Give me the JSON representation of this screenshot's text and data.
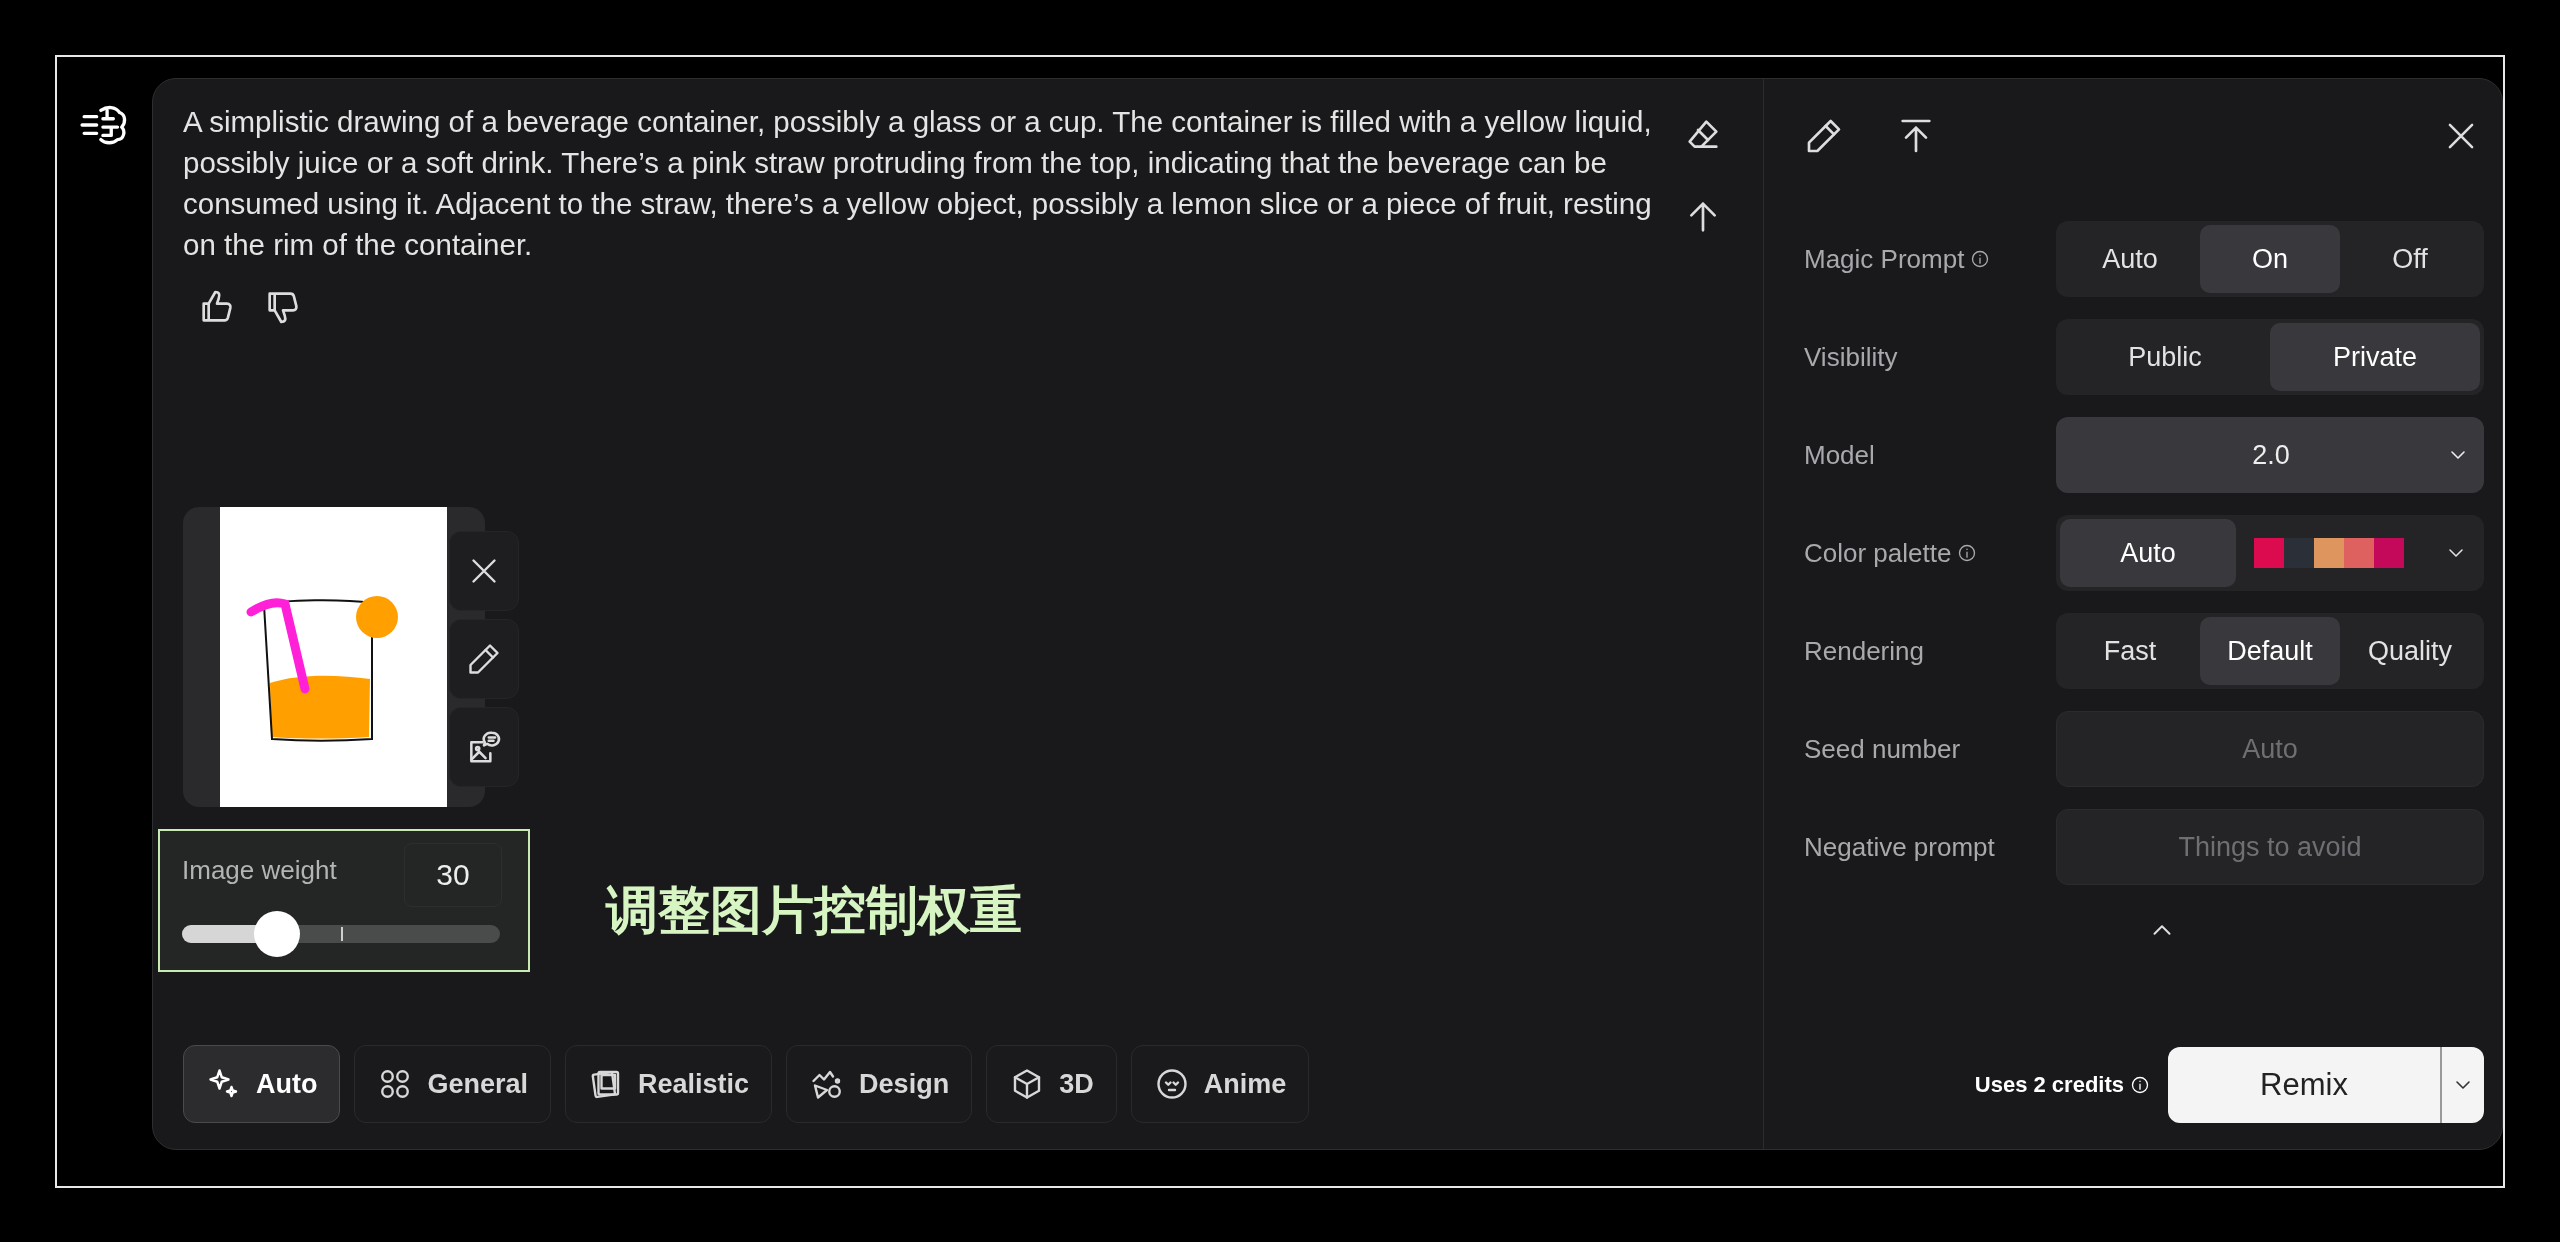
{
  "prompt": {
    "text": "A simplistic drawing of a beverage container, possibly a glass or a cup. The container is filled with a yellow liquid, possibly juice or a soft drink. There’s a pink straw protruding from the top, indicating that the beverage can be consumed using it. Adjacent to the straw, there’s a yellow object, possibly a lemon slice or a piece of fruit, resting on the rim of the container."
  },
  "image_weight": {
    "label": "Image weight",
    "value": "30",
    "level": 0.3
  },
  "annotation": {
    "text": "调整图片控制权重"
  },
  "styles": [
    {
      "kind": "auto",
      "label": "Auto",
      "selected": true
    },
    {
      "kind": "general",
      "label": "General",
      "selected": false
    },
    {
      "kind": "realistic",
      "label": "Realistic",
      "selected": false
    },
    {
      "kind": "design",
      "label": "Design",
      "selected": false
    },
    {
      "kind": "cube",
      "label": "3D",
      "selected": false
    },
    {
      "kind": "anime",
      "label": "Anime",
      "selected": false
    }
  ],
  "settings": [
    {
      "kind": "segmented",
      "label": "Magic Prompt",
      "info": true,
      "options": [
        {
          "label": "Auto",
          "selected": false
        },
        {
          "label": "On",
          "selected": true
        },
        {
          "label": "Off",
          "selected": false
        }
      ]
    },
    {
      "kind": "segmented",
      "label": "Visibility",
      "info": false,
      "options": [
        {
          "label": "Public",
          "selected": false
        },
        {
          "label": "Private",
          "selected": true
        }
      ]
    },
    {
      "kind": "dropdown",
      "label": "Model",
      "info": false,
      "value": "2.0"
    },
    {
      "kind": "palette",
      "label": "Color palette",
      "info": true,
      "auto": {
        "label": "Auto",
        "selected": true
      },
      "swatches": [
        {
          "color": "#dc0a4e"
        },
        {
          "color": "#2b2f38"
        },
        {
          "color": "#df955e"
        },
        {
          "color": "#de6160"
        },
        {
          "color": "#c4085a"
        }
      ]
    },
    {
      "kind": "segmented",
      "label": "Rendering",
      "info": false,
      "options": [
        {
          "label": "Fast",
          "selected": false
        },
        {
          "label": "Default",
          "selected": true
        },
        {
          "label": "Quality",
          "selected": false
        }
      ]
    },
    {
      "kind": "input",
      "label": "Seed number",
      "info": false,
      "placeholder": "Auto"
    },
    {
      "kind": "input",
      "label": "Negative prompt",
      "info": false,
      "placeholder": "Things to avoid"
    }
  ],
  "footer": {
    "credits": "Uses 2 credits",
    "button": "Remix"
  }
}
